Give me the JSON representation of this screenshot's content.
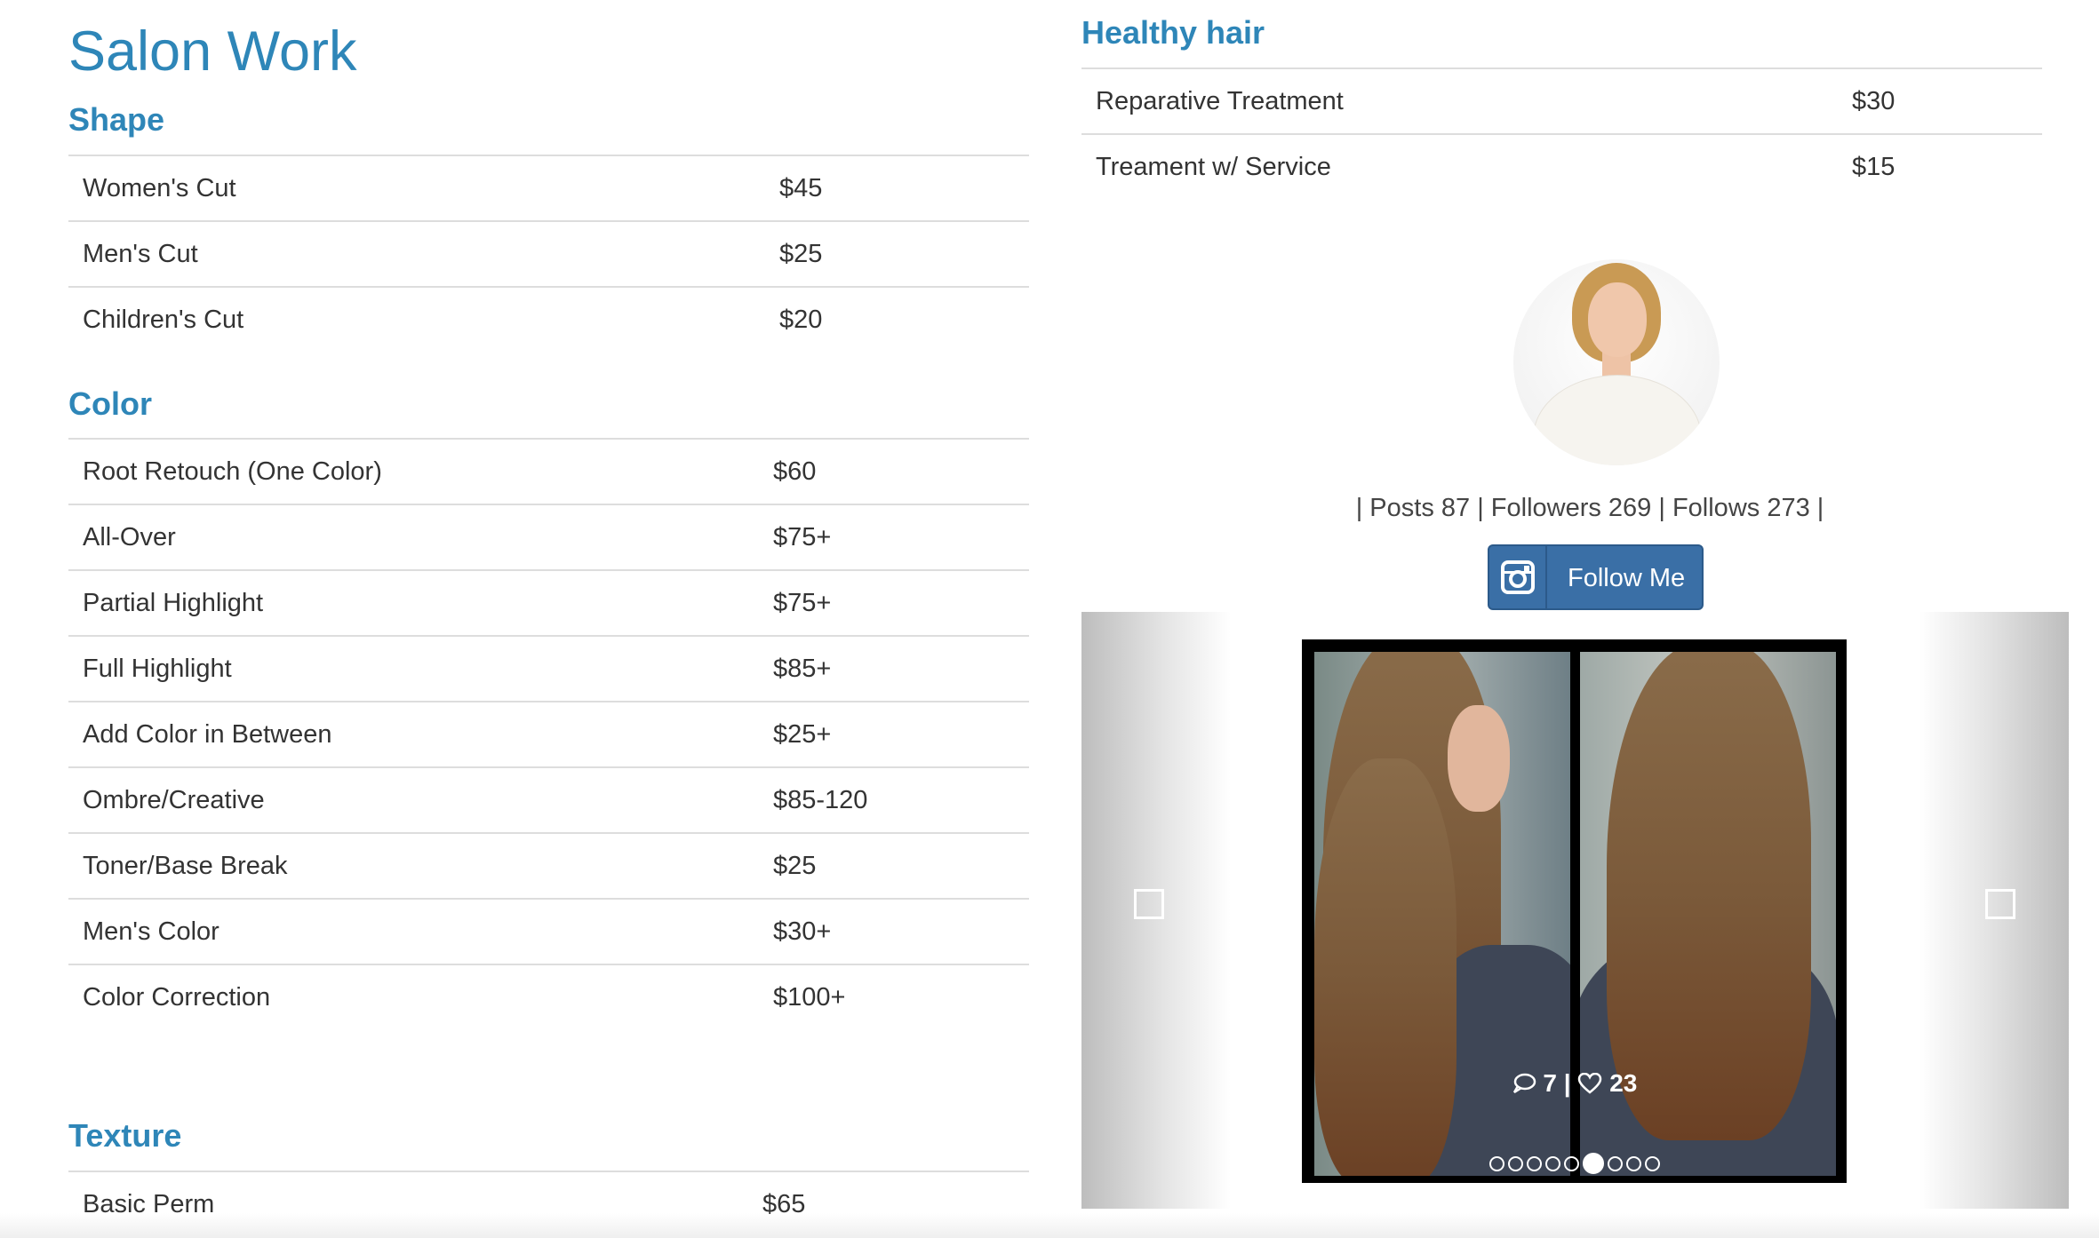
{
  "page": {
    "title": "Salon Work"
  },
  "sections": {
    "shape": {
      "title": "Shape",
      "rows": [
        {
          "service": "Women's Cut",
          "price": "$45"
        },
        {
          "service": "Men's Cut",
          "price": "$25"
        },
        {
          "service": "Children's Cut",
          "price": "$20"
        }
      ]
    },
    "color": {
      "title": "Color",
      "rows": [
        {
          "service": "Root Retouch (One Color)",
          "price": "$60"
        },
        {
          "service": "All-Over",
          "price": "$75+"
        },
        {
          "service": "Partial Highlight",
          "price": "$75+"
        },
        {
          "service": "Full Highlight",
          "price": "$85+"
        },
        {
          "service": "Add Color in Between",
          "price": "$25+"
        },
        {
          "service": "Ombre/Creative",
          "price": "$85-120"
        },
        {
          "service": "Toner/Base Break",
          "price": "$25"
        },
        {
          "service": "Men's Color",
          "price": "$30+"
        },
        {
          "service": "Color Correction",
          "price": "$100+"
        }
      ]
    },
    "texture": {
      "title": "Texture",
      "rows": [
        {
          "service": "Basic Perm",
          "price": "$65"
        }
      ]
    },
    "healthy_hair": {
      "title": "Healthy hair",
      "rows": [
        {
          "service": "Reparative Treatment",
          "price": "$30"
        },
        {
          "service": "Treament w/ Service",
          "price": "$15"
        }
      ]
    }
  },
  "instagram": {
    "stats": "| Posts 87 | Followers 269 | Follows 273 |",
    "follow_label": "Follow Me",
    "icon": "instagram-icon",
    "accent": "#3a6fa6",
    "carousel": {
      "comments": "7",
      "separator": "|",
      "likes": "23",
      "slide_count": 9,
      "active_index": 5
    }
  },
  "colors": {
    "heading": "#2e86b8",
    "text": "#333333",
    "divider": "#dddddd"
  }
}
